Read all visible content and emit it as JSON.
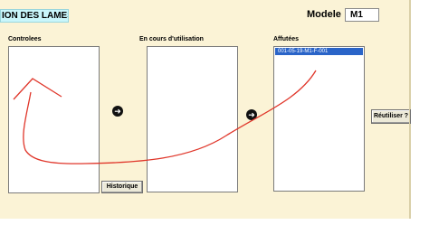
{
  "header": {
    "title": "ION DES LAMES",
    "modele_label": "Modele",
    "modele_value": "M1"
  },
  "columns": {
    "controlees": {
      "label": "Controlees"
    },
    "en_cours": {
      "label": "En cours d'utilisation"
    },
    "affutees": {
      "label": "Affutées",
      "items": [
        "001-05-19-M1-F-001"
      ]
    }
  },
  "buttons": {
    "historique": "Historique",
    "reutiliser": "Réutiliser ?",
    "arrow_glyph": "➜"
  },
  "colors": {
    "background": "#fbf3d6",
    "title_box": "#c9f6fb",
    "selection": "#2a64c8",
    "annotation": "#e0362a"
  },
  "icons": {
    "move_right": "arrow-right-circle-icon"
  }
}
